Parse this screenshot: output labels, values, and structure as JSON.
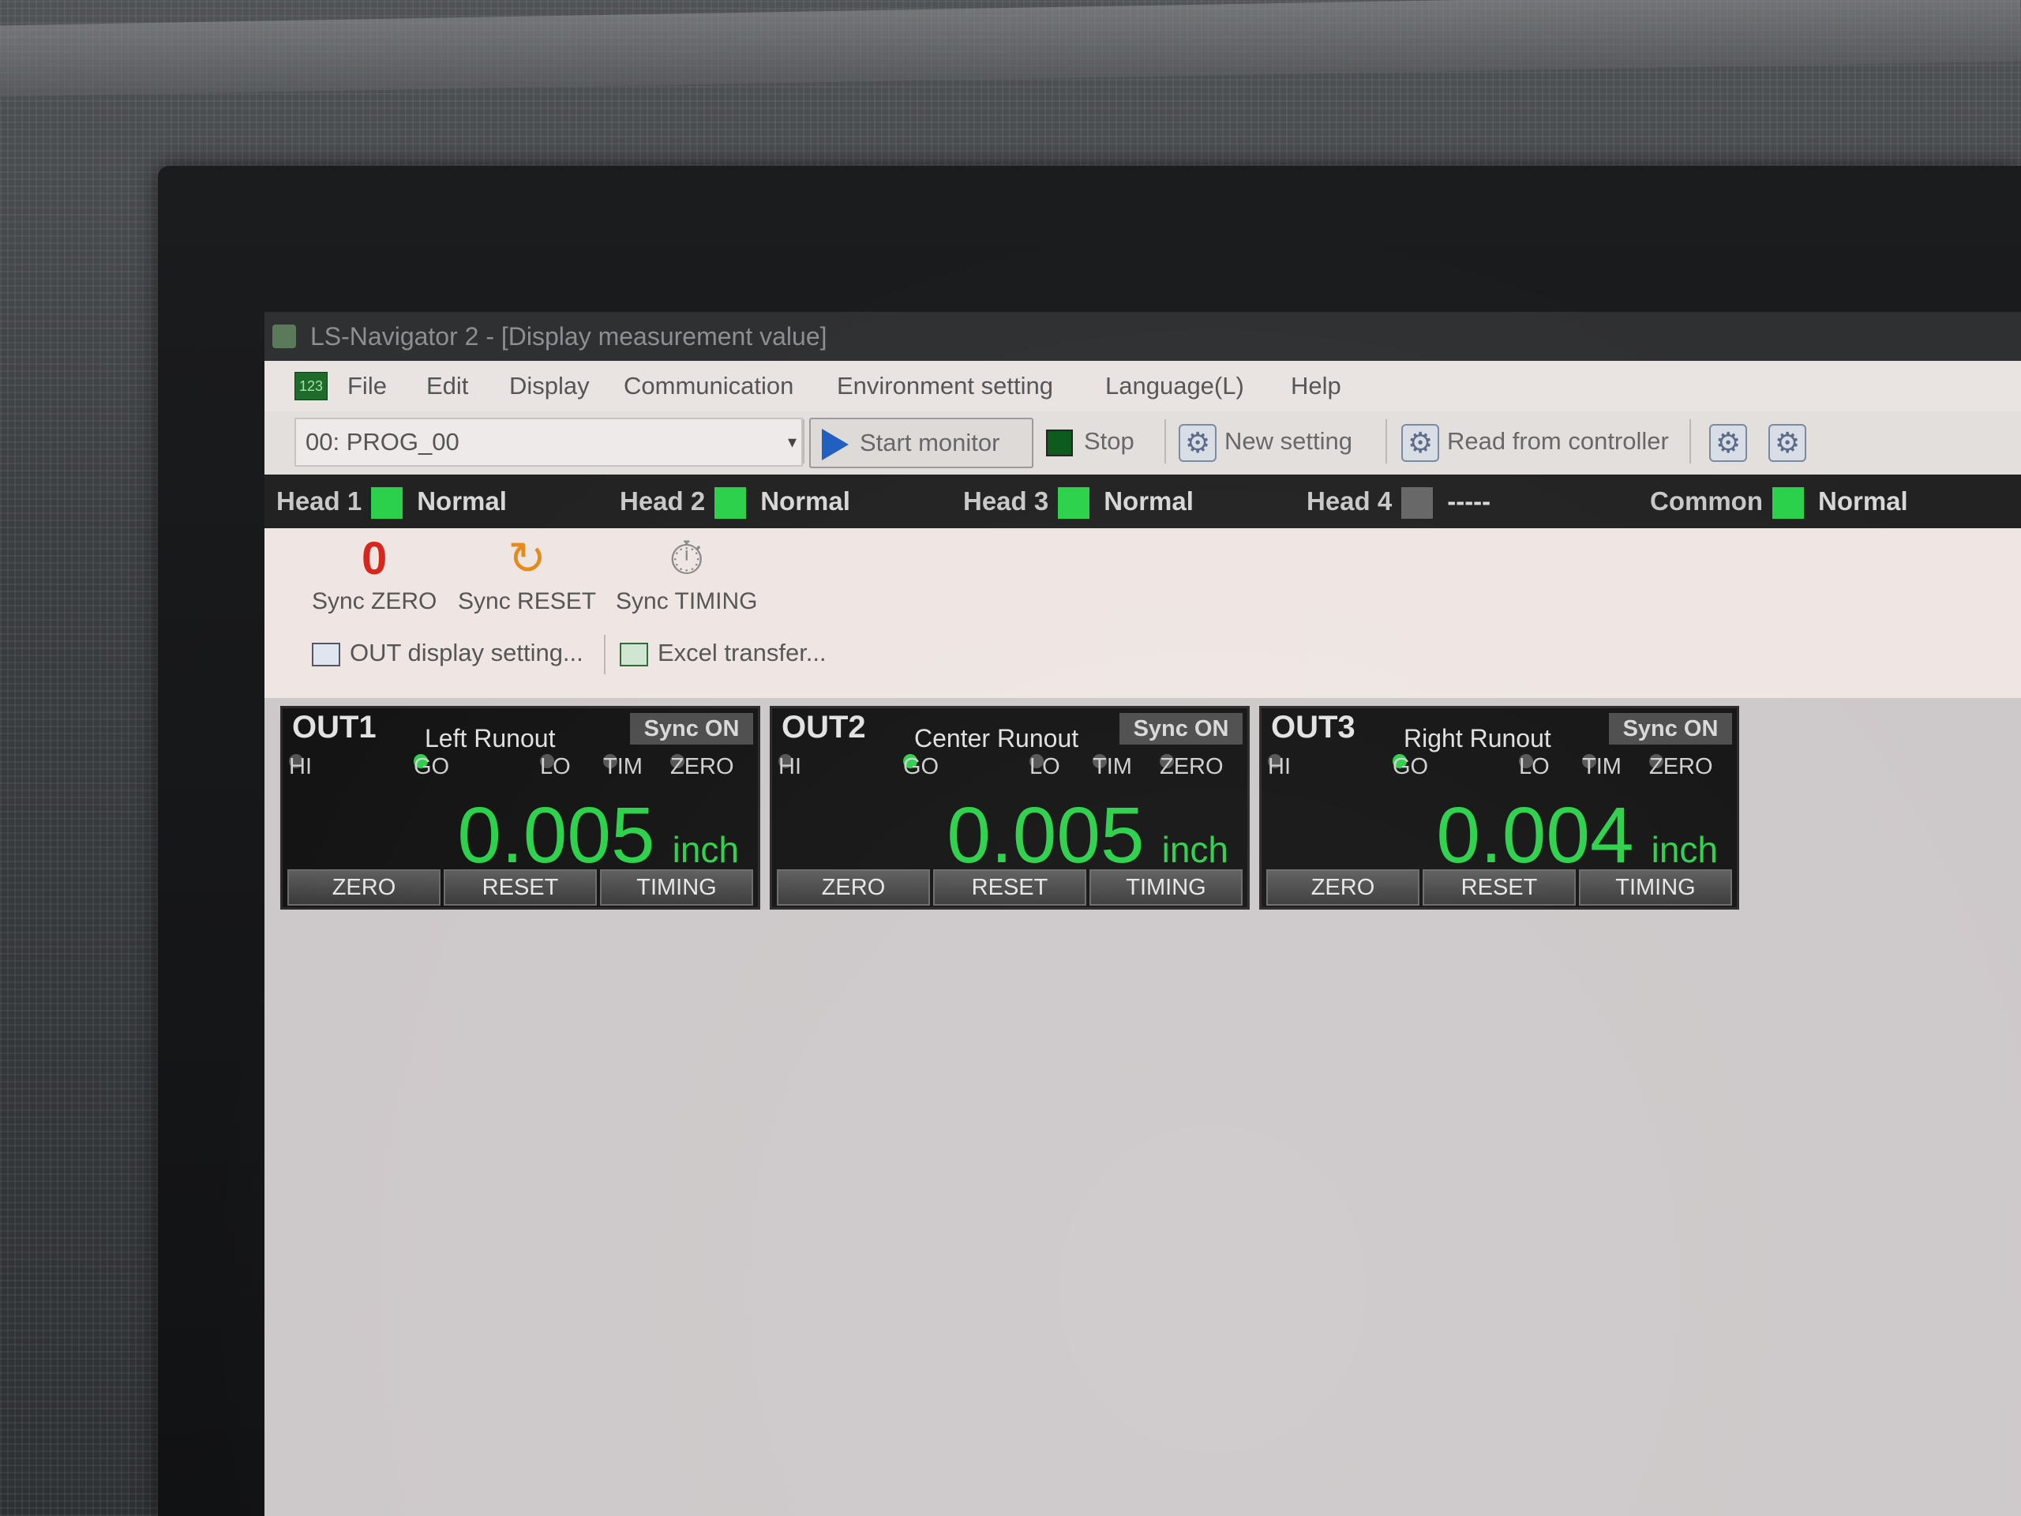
{
  "window": {
    "title": "LS-Navigator 2 - [Display measurement value]"
  },
  "menu": {
    "icon_text": "123",
    "items": [
      "File",
      "Edit",
      "Display",
      "Communication",
      "Environment setting",
      "Language(L)",
      "Help"
    ]
  },
  "toolbar": {
    "program": "00: PROG_00",
    "start_label": "Start monitor",
    "stop_label": "Stop",
    "new_setting_label": "New setting",
    "read_label": "Read from controller"
  },
  "status": {
    "heads": [
      {
        "label": "Head 1",
        "state": "Normal"
      },
      {
        "label": "Head 2",
        "state": "Normal"
      },
      {
        "label": "Head 3",
        "state": "Normal"
      },
      {
        "label": "Head 4",
        "state": "-----"
      },
      {
        "label": "Common",
        "state": "Normal"
      }
    ],
    "colors": {
      "normal": "#2bd14a",
      "inactive": "#666666"
    }
  },
  "sync": {
    "zero_label": "Sync ZERO",
    "reset_label": "Sync RESET",
    "timing_label": "Sync TIMING",
    "out_display_label": "OUT display setting...",
    "excel_label": "Excel transfer..."
  },
  "outputs": [
    {
      "name": "OUT1",
      "label": "Left Runout",
      "sync": "Sync  ON",
      "value": "0.005",
      "unit": "inch"
    },
    {
      "name": "OUT2",
      "label": "Center Runout",
      "sync": "Sync  ON",
      "value": "0.005",
      "unit": "inch"
    },
    {
      "name": "OUT3",
      "label": "Right Runout",
      "sync": "Sync  ON",
      "value": "0.004",
      "unit": "inch"
    }
  ],
  "judgement": {
    "hi": "HI",
    "go": "GO",
    "lo": "LO",
    "tim": "TIM",
    "zero": "ZERO"
  },
  "out_buttons": {
    "zero": "ZERO",
    "reset": "RESET",
    "timing": "TIMING"
  },
  "value_color": "#2bd14a"
}
